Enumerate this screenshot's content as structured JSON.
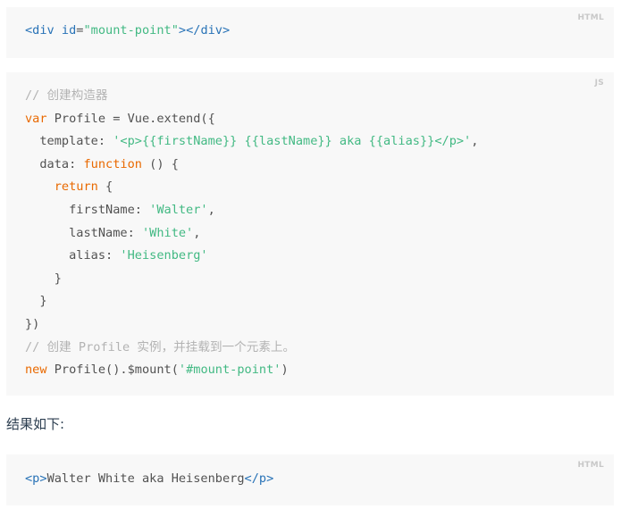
{
  "block1": {
    "lang": "HTML",
    "line1": {
      "t1": "<div ",
      "t2": "id",
      "t3": "=",
      "t4": "\"mount-point\"",
      "t5": "></div>"
    }
  },
  "block2": {
    "lang": "JS",
    "l1": "// 创建构造器",
    "l2": {
      "kw": "var",
      "rest": " Profile = Vue.extend({"
    },
    "l3": {
      "pre": "  template: ",
      "str": "'<p>{{firstName}} {{lastName}} aka {{alias}}</p>'",
      "post": ","
    },
    "l4": {
      "pre": "  data: ",
      "kw": "function",
      "post": " () {"
    },
    "l5": {
      "pre": "    ",
      "kw": "return",
      "post": " {"
    },
    "l6": {
      "pre": "      firstName: ",
      "str": "'Walter'",
      "post": ","
    },
    "l7": {
      "pre": "      lastName: ",
      "str": "'White'",
      "post": ","
    },
    "l8": {
      "pre": "      alias: ",
      "str": "'Heisenberg'",
      "post": ""
    },
    "l9": "    }",
    "l10": "  }",
    "l11": "})",
    "l12": "// 创建 Profile 实例，并挂载到一个元素上。",
    "l13": {
      "kw": "new",
      "pre": " Profile().$mount(",
      "str": "'#mount-point'",
      "post": ")"
    }
  },
  "paragraph": "结果如下:",
  "block3": {
    "lang": "HTML",
    "line1": {
      "t1": "<p>",
      "t2": "Walter White aka Heisenberg",
      "t3": "</p>"
    }
  }
}
